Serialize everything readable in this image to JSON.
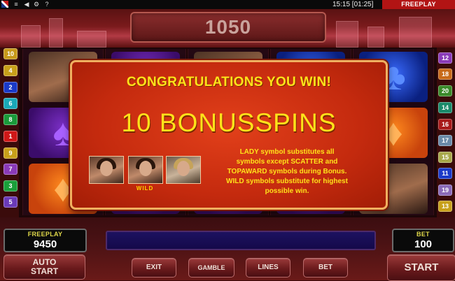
{
  "topbar": {
    "flag_icon": "uk-flag-icon",
    "clock": "15:15 [01:25]",
    "mode_badge": "FREEPLAY"
  },
  "header": {
    "win_display": "1050"
  },
  "line_numbers": {
    "left": [
      "10",
      "4",
      "2",
      "6",
      "8",
      "1",
      "9",
      "7",
      "3",
      "5"
    ],
    "right": [
      "12",
      "18",
      "20",
      "14",
      "16",
      "17",
      "15",
      "11",
      "19",
      "13"
    ]
  },
  "popup": {
    "title": "CONGRATULATIONS YOU WIN!",
    "bonus": "10 BONUSSPINS",
    "wild_label": "WILD",
    "desc_lines": [
      "LADY symbol substitutes all",
      "symbols except SCATTER and",
      "TOPAWARD symbols during Bonus.",
      "WILD symbols substitute for highest",
      "possible win."
    ]
  },
  "panels": {
    "credit": {
      "label": "FREEPLAY",
      "value": "9450"
    },
    "bet": {
      "label": "BET",
      "value": "100"
    }
  },
  "buttons": {
    "autostart": [
      "AUTO",
      "START"
    ],
    "exit": "EXIT",
    "gamble": "GAMBLE",
    "lines": "LINES",
    "bet": "BET",
    "start": "START"
  },
  "colors": {
    "popup_bg": "#c42a0e",
    "popup_text": "#ffe21a",
    "badge_red": "#b21414",
    "panel_label": "#e0d84a"
  }
}
